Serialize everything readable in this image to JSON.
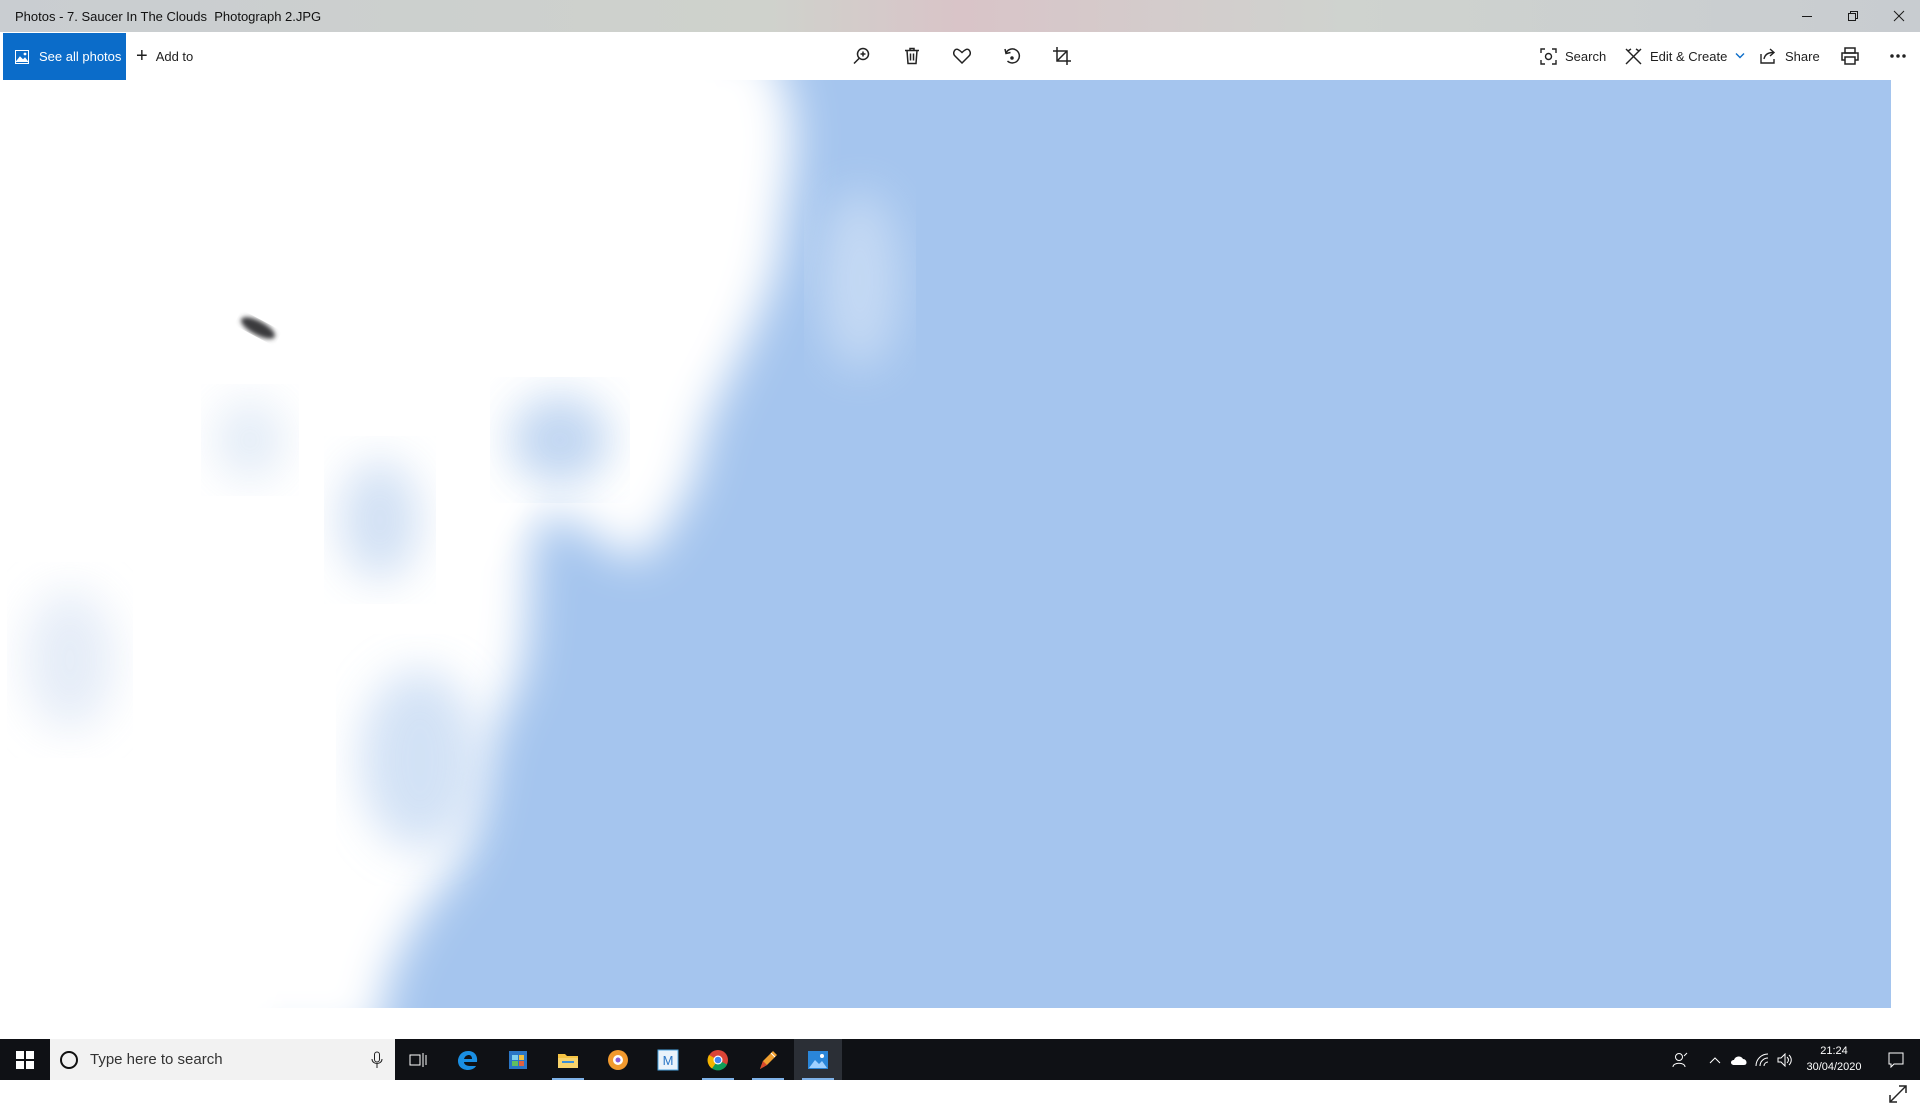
{
  "window": {
    "title": "Photos - 7. Saucer In The Clouds  Photograph 2.JPG"
  },
  "toolbar": {
    "see_all_label": "See all photos",
    "add_to_label": "Add to",
    "search_label": "Search",
    "edit_create_label": "Edit & Create",
    "share_label": "Share",
    "icons": [
      "zoom-icon",
      "delete-icon",
      "favorite-icon",
      "rotate-icon",
      "crop-icon",
      "print-icon",
      "more-icon"
    ]
  },
  "colors": {
    "accent": "#0b6cc9",
    "sky": "#a5c5ee",
    "cloud": "#ffffff",
    "taskbar": "#0f1115"
  },
  "taskbar": {
    "search_placeholder": "Type here to search",
    "apps": [
      "task-view-icon",
      "edge-icon",
      "store-icon",
      "file-explorer-icon",
      "app-orange-icon",
      "app-m-icon",
      "chrome-icon",
      "app-pen-icon",
      "photos-icon"
    ],
    "time": "21:24",
    "date": "30/04/2020"
  }
}
